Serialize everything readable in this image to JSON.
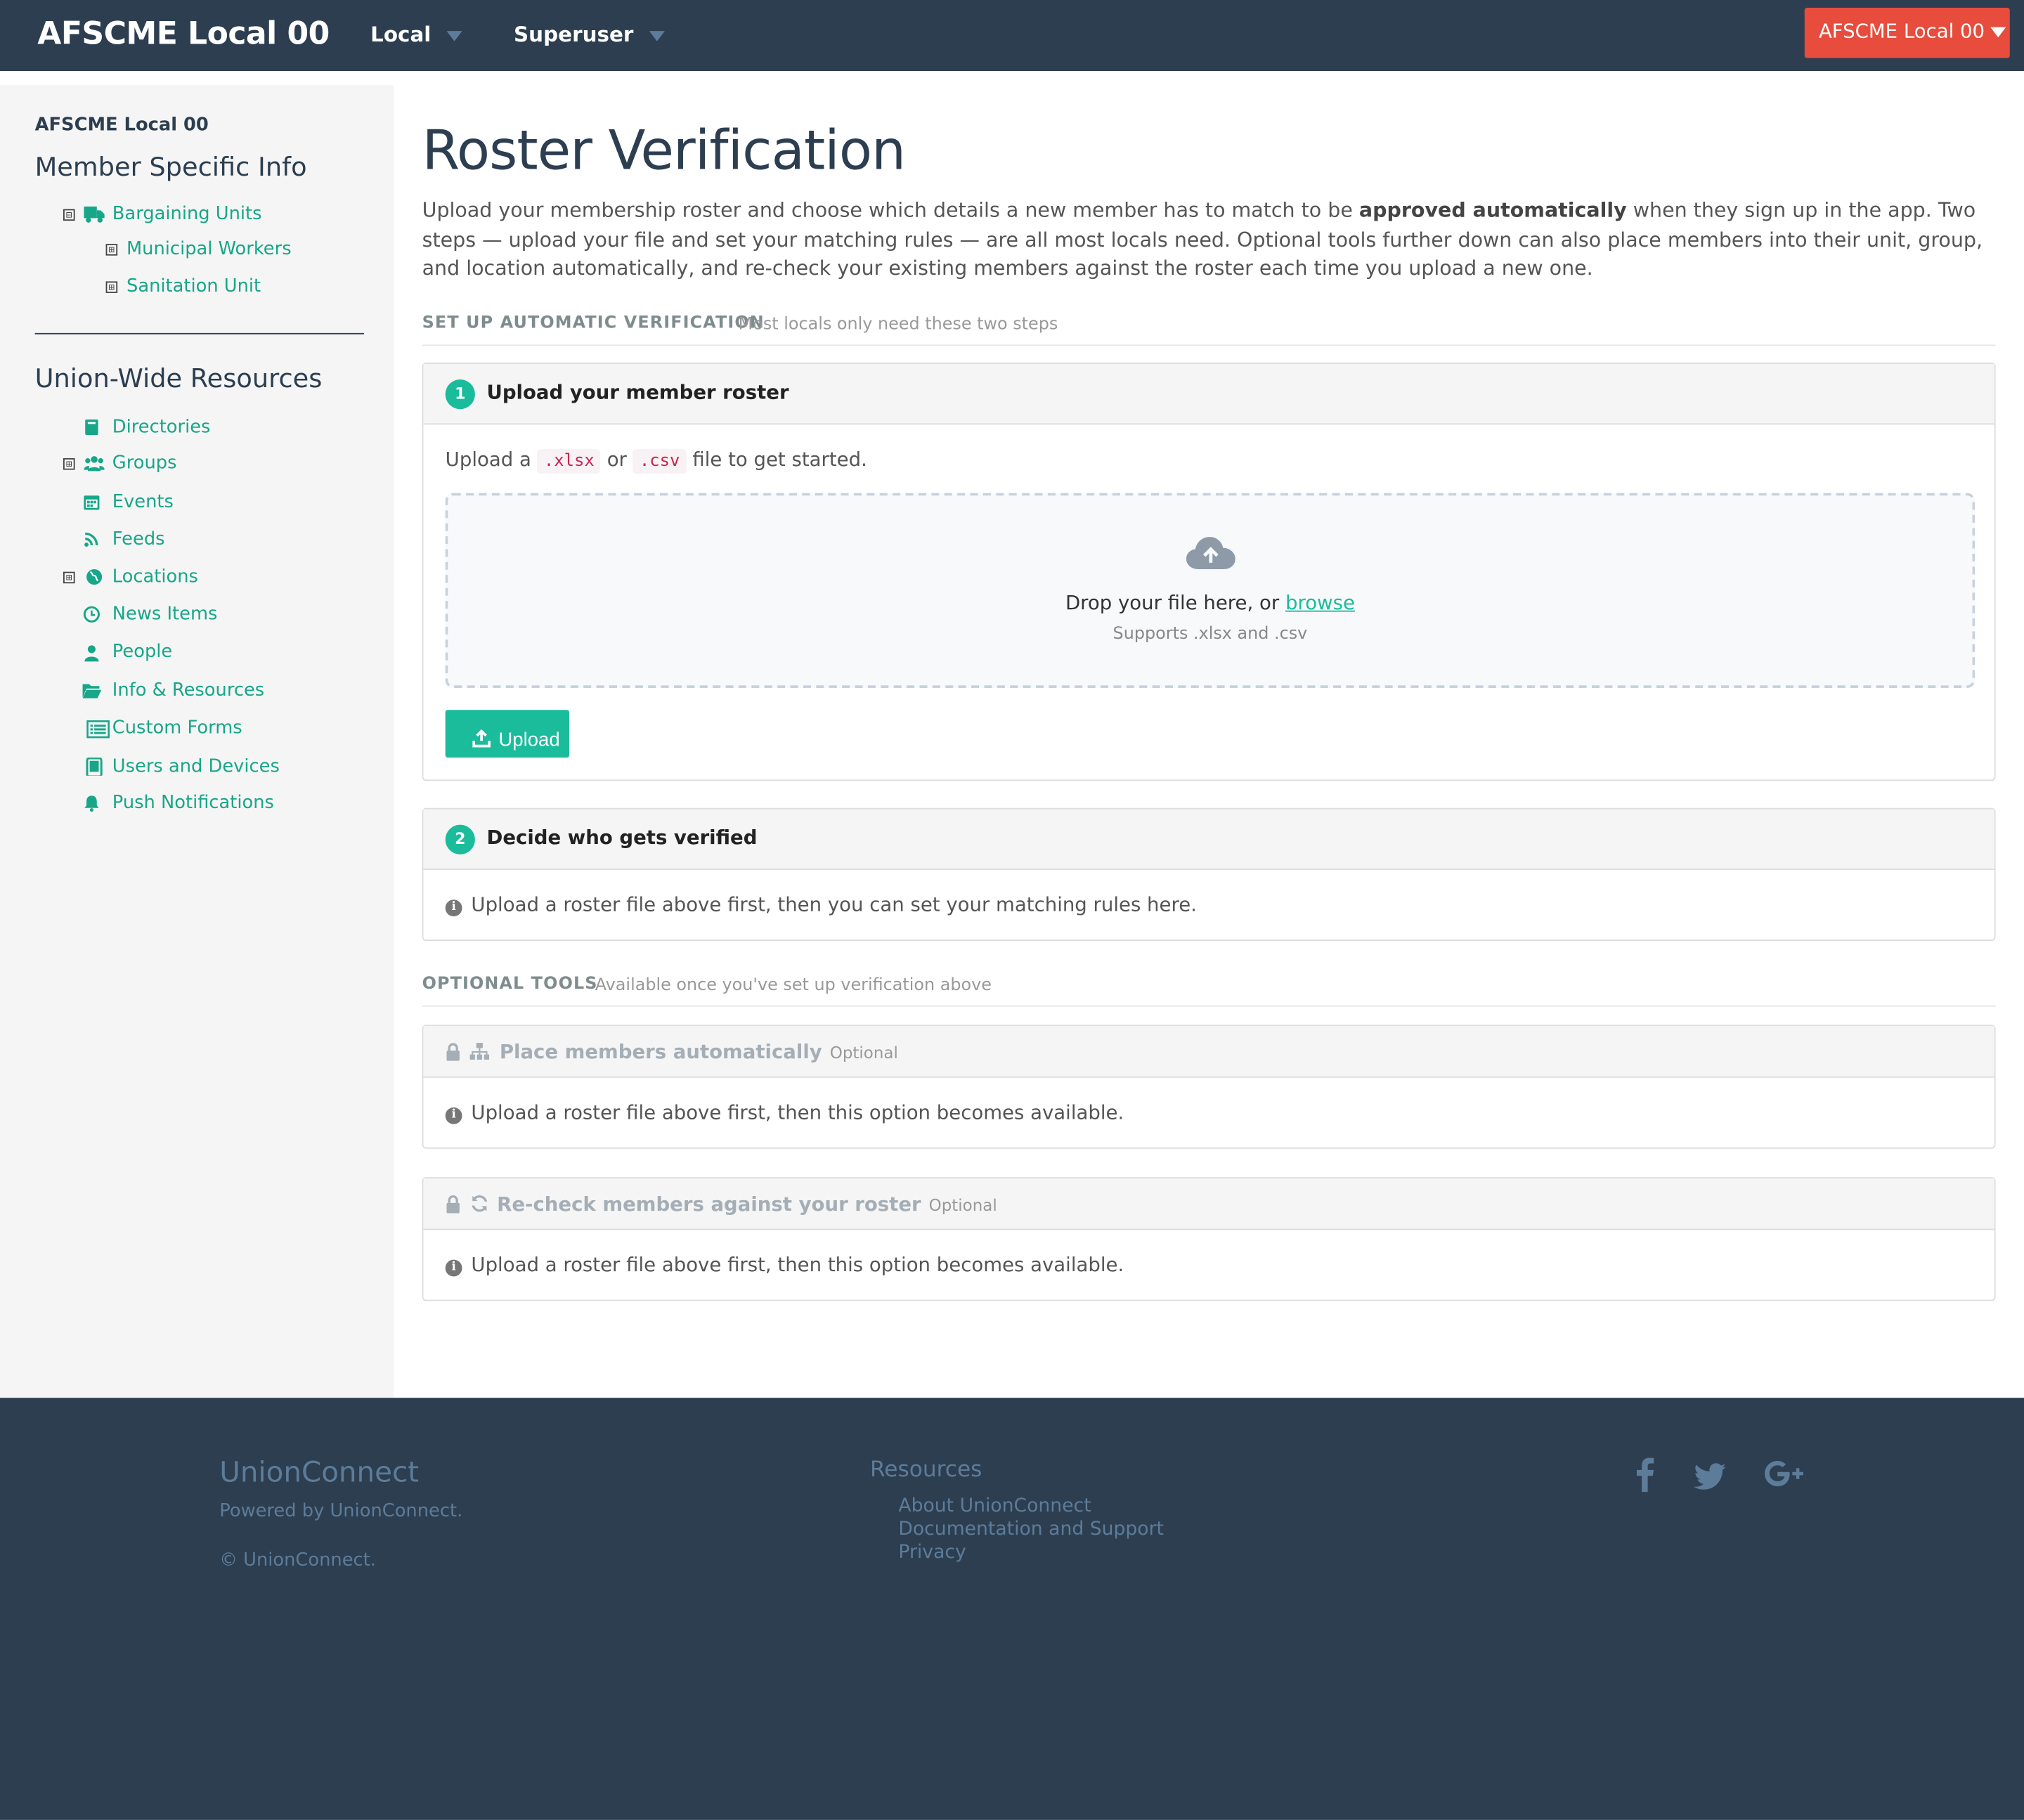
{
  "navbar": {
    "brand": "AFSCME Local 00",
    "menus": [
      "Local",
      "Superuser"
    ],
    "org_button": "AFSCME Local 00"
  },
  "sidebar": {
    "org": "AFSCME Local 00",
    "member_heading": "Member Specific Info",
    "member_items": [
      {
        "label": "Bargaining Units",
        "icon": "truck-icon",
        "toggle": "⊟"
      },
      {
        "label": "Municipal Workers",
        "toggle": "⊞"
      },
      {
        "label": "Sanitation Unit",
        "toggle": "⊞"
      }
    ],
    "union_heading": "Union-Wide Resources",
    "union_items": [
      {
        "label": "Directories",
        "icon": "book-icon"
      },
      {
        "label": "Groups",
        "icon": "users-icon",
        "toggle": "⊞"
      },
      {
        "label": "Events",
        "icon": "calendar-icon"
      },
      {
        "label": "Feeds",
        "icon": "rss-icon"
      },
      {
        "label": "Locations",
        "icon": "globe-icon",
        "toggle": "⊞"
      },
      {
        "label": "News Items",
        "icon": "clock-icon"
      },
      {
        "label": "People",
        "icon": "person-icon"
      },
      {
        "label": "Info & Resources",
        "icon": "folder-open-icon"
      },
      {
        "label": "Custom Forms",
        "icon": "list-icon"
      },
      {
        "label": "Users and Devices",
        "icon": "tablet-icon"
      },
      {
        "label": "Push Notifications",
        "icon": "bell-icon"
      }
    ]
  },
  "main": {
    "title": "Roster Verification",
    "intro_before": "Upload your membership roster and choose which details a new member has to match to be ",
    "intro_bold": "approved automatically",
    "intro_after": " when they sign up in the app. Two steps — upload your file and set your matching rules — are all most locals need. Optional tools further down can also place members into their unit, group, and location automatically, and re-check your existing members against the roster each time you upload a new one.",
    "section1": {
      "key": "SET UP AUTOMATIC VERIFICATION",
      "desc": "Most locals only need these two steps"
    },
    "step1": {
      "number": "1",
      "title": "Upload your member roster",
      "prompt_a": "Upload a",
      "ext1": ".xlsx",
      "prompt_or": "or",
      "ext2": ".csv",
      "prompt_b": "file to get started.",
      "drop_text": "Drop your file here, or",
      "browse": "browse",
      "drop_sub": "Supports .xlsx and .csv",
      "upload_label": "Upload"
    },
    "step2": {
      "number": "2",
      "title": "Decide who gets verified",
      "info": "Upload a roster file above first, then you can set your matching rules here."
    },
    "section2": {
      "key": "OPTIONAL TOOLS",
      "desc": "Available once you've set up verification above"
    },
    "tool1": {
      "title": "Place members automatically",
      "tag": "Optional",
      "info": "Upload a roster file above first, then this option becomes available."
    },
    "tool2": {
      "title": "Re-check members against your roster",
      "tag": "Optional",
      "info": "Upload a roster file above first, then this option becomes available."
    }
  },
  "footer": {
    "brand": "UnionConnect",
    "powered": "Powered by UnionConnect.",
    "copyright": "© UnionConnect.",
    "resources_heading": "Resources",
    "links": [
      "About UnionConnect",
      "Documentation and Support",
      "Privacy"
    ],
    "social": [
      "facebook-icon",
      "twitter-icon",
      "google-plus-icon"
    ]
  },
  "colors": {
    "navy": "#2c3e50",
    "accent": "#1abc9c",
    "sidebar_link": "#18a689",
    "danger": "#e74c3c",
    "footer_text": "#5d7c99"
  }
}
